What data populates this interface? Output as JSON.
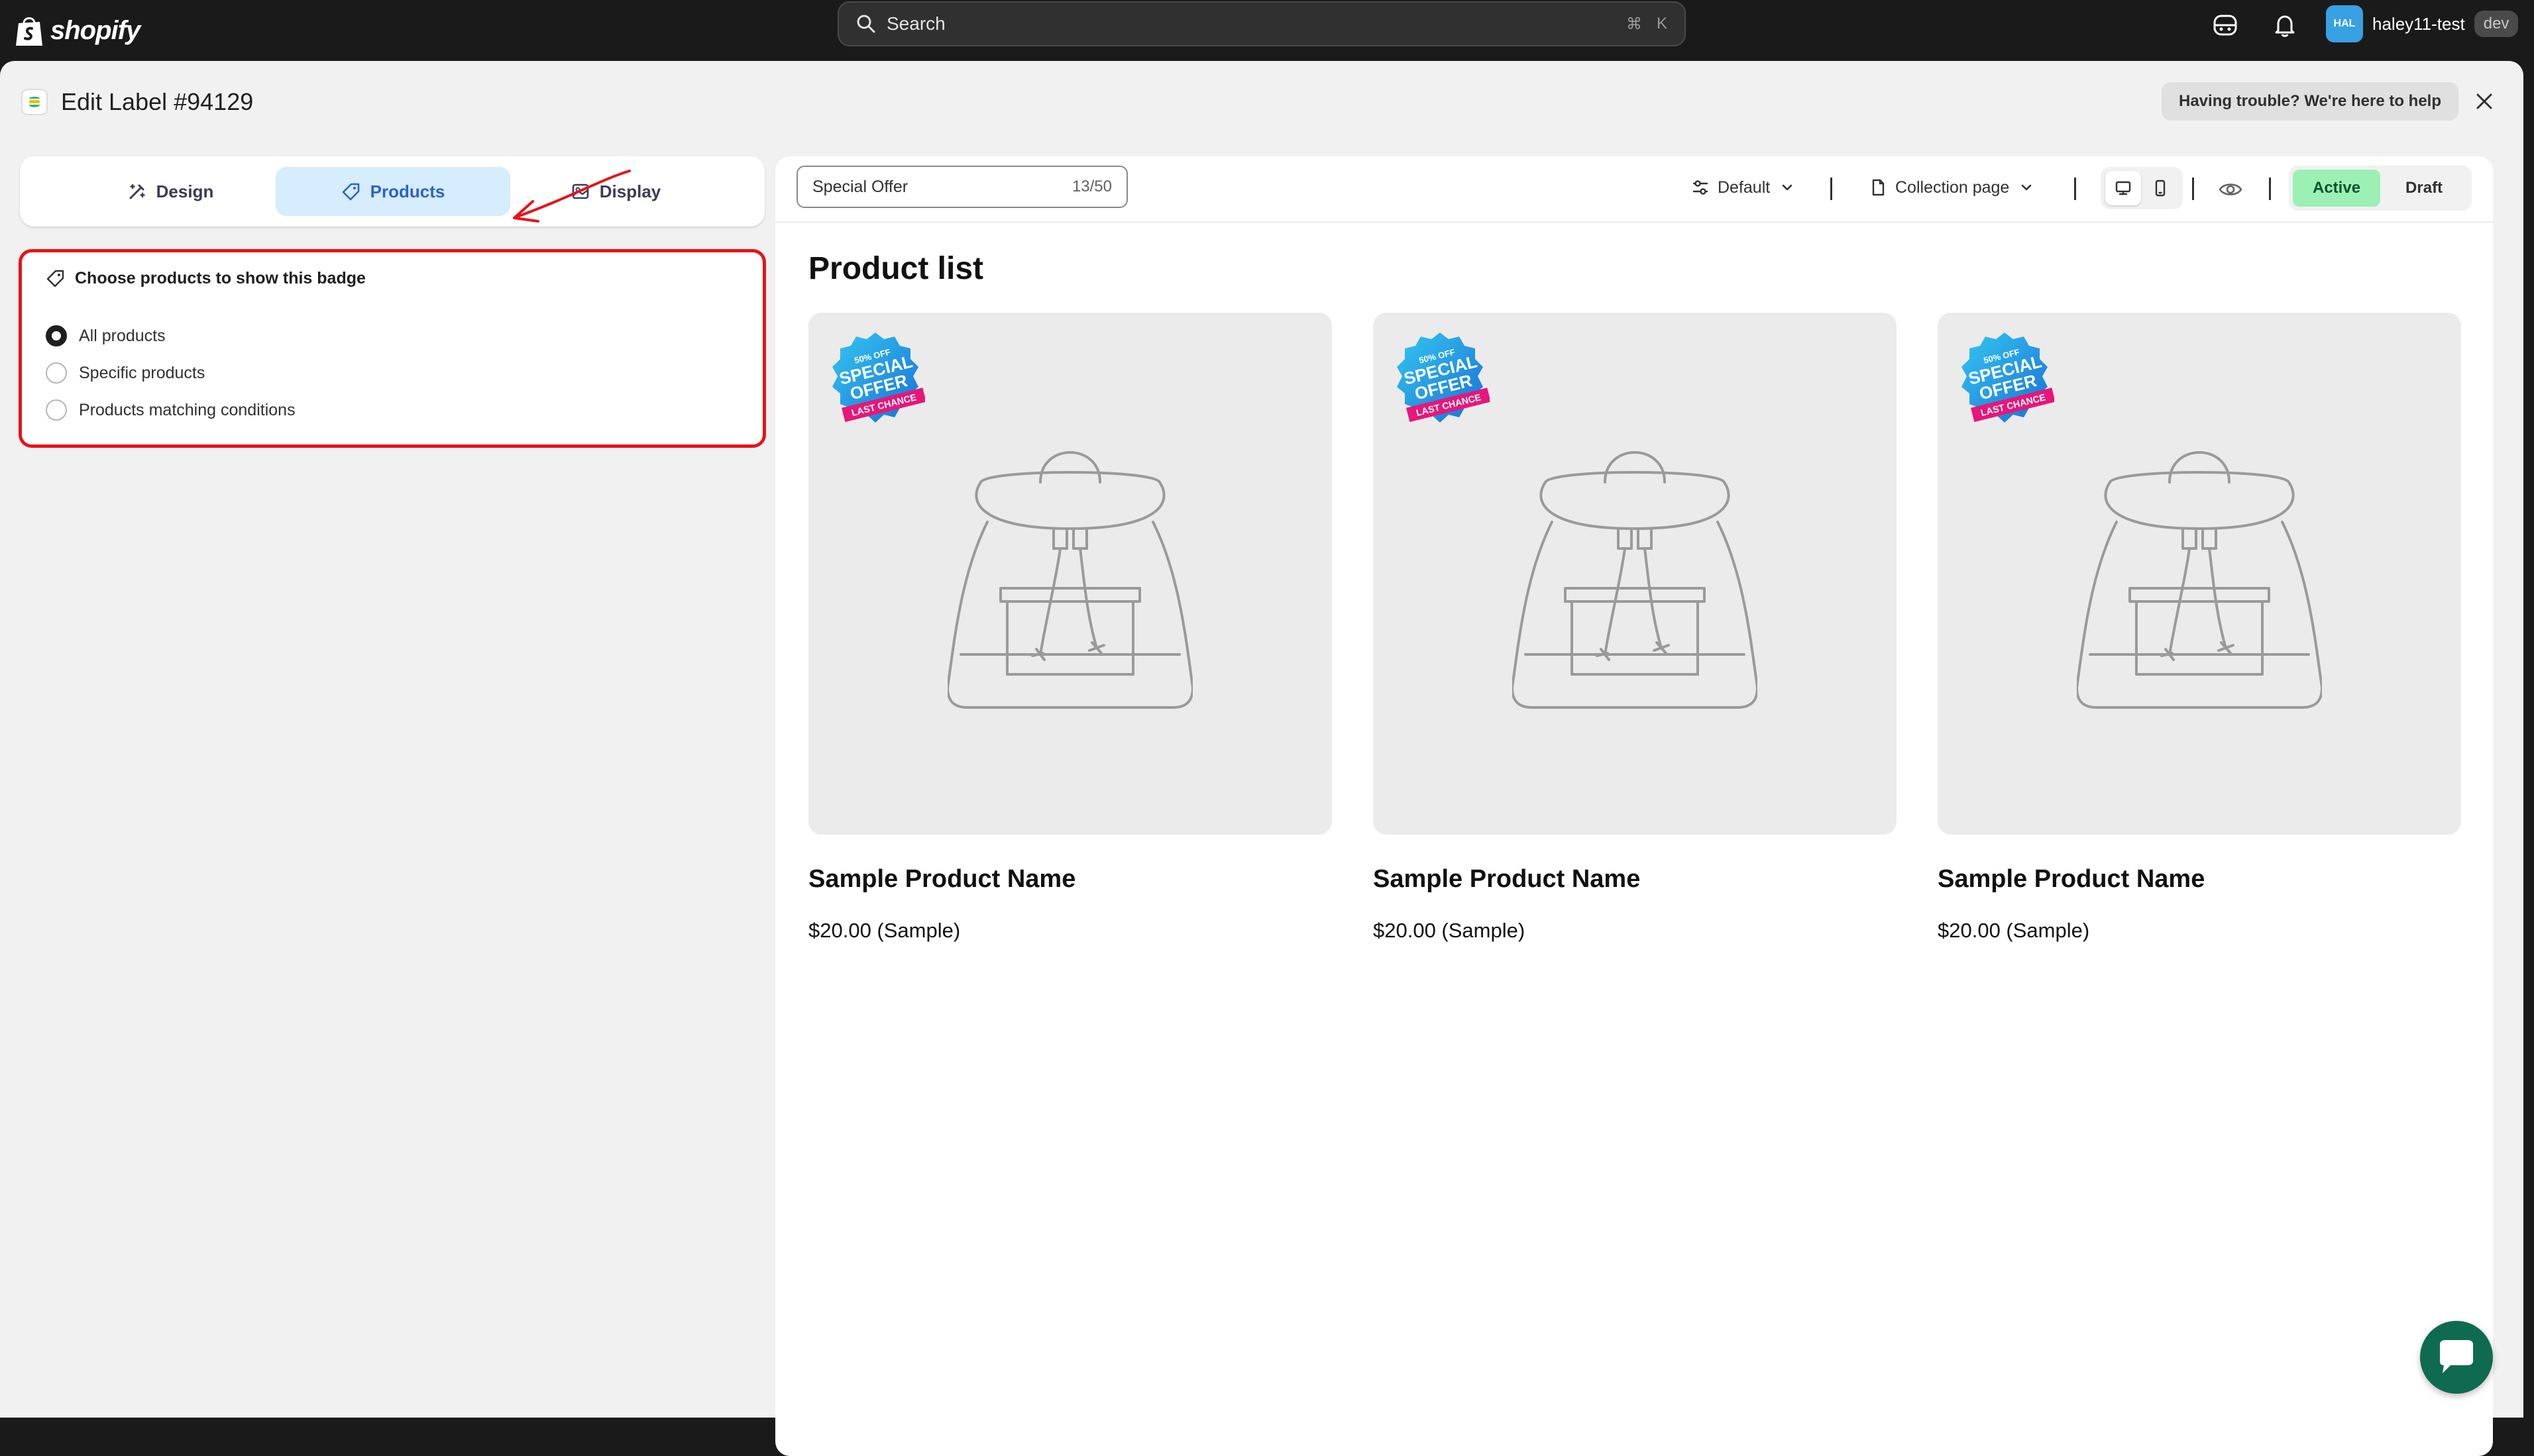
{
  "topbar": {
    "logo_text": "shopify",
    "search_placeholder": "Search",
    "search_kbd_cmd": "⌘",
    "search_kbd_key": "K",
    "avatar_initials": "HAL",
    "user_name": "haley11-test",
    "dev_badge": "dev"
  },
  "header": {
    "title": "Edit Label #94129",
    "help_button": "Having trouble? We're here to help"
  },
  "tabs": [
    {
      "label": "Design",
      "icon": "design-icon"
    },
    {
      "label": "Products",
      "icon": "tag-icon"
    },
    {
      "label": "Display",
      "icon": "display-icon"
    }
  ],
  "products_section": {
    "heading": "Choose products to show this badge",
    "options": [
      {
        "label": "All products",
        "checked": true
      },
      {
        "label": "Specific products",
        "checked": false
      },
      {
        "label": "Products matching conditions",
        "checked": false
      }
    ]
  },
  "toolbar": {
    "label_name": "Special Offer",
    "char_count": "13/50",
    "position_select": "Default",
    "page_select": "Collection page",
    "status_active": "Active",
    "status_draft": "Draft"
  },
  "preview": {
    "title": "Product list",
    "products": [
      {
        "name": "Sample Product Name",
        "price": "$20.00 (Sample)"
      },
      {
        "name": "Sample Product Name",
        "price": "$20.00 (Sample)"
      },
      {
        "name": "Sample Product Name",
        "price": "$20.00 (Sample)"
      }
    ],
    "badge": {
      "line1": "50% OFF",
      "line2": "SPECIAL",
      "line3": "OFFER",
      "ribbon": "LAST CHANCE"
    }
  },
  "colors": {
    "accent": "#2b62c9",
    "active_status": "#9cf0b4",
    "highlight_border": "#e5141b",
    "chat_button": "#0f6b4f"
  }
}
